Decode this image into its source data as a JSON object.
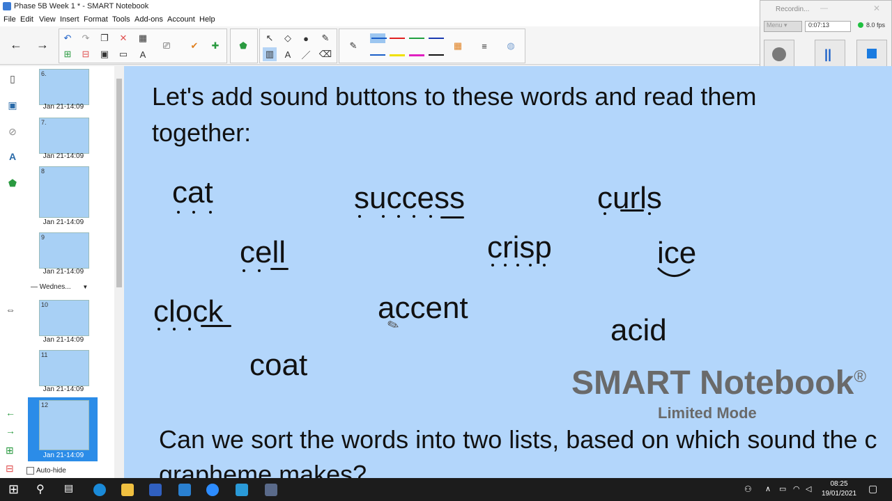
{
  "window": {
    "title": "Phase 5B Week 1 * - SMART Notebook"
  },
  "menu": [
    "File",
    "Edit",
    "View",
    "Insert",
    "Format",
    "Tools",
    "Add-ons",
    "Account",
    "Help"
  ],
  "toolbar": {
    "icons": [
      "back-arrow-icon",
      "forward-arrow-icon",
      "undo-icon",
      "redo-icon",
      "delete-icon",
      "table-icon",
      "screen-shade-icon",
      "shapes-icon",
      "select-icon",
      "pen-icon"
    ],
    "pen_colors": [
      "#1a5fc8",
      "#e02020",
      "#20a040",
      "#1a3ab0",
      "#1a5fc8",
      "#f0e000",
      "#e020c0",
      "#111111"
    ]
  },
  "recorder": {
    "title": "Recordin...",
    "mode": "Menu",
    "elapsed": "0:07:13",
    "fps": "8.0 fps"
  },
  "pages": [
    {
      "num": "6.",
      "date": "Jan 21-14:09"
    },
    {
      "num": "7.",
      "date": "Jan 21-14:09"
    },
    {
      "num": "8",
      "date": "Jan 21-14:09"
    },
    {
      "num": "9",
      "date": "Jan 21-14:09"
    },
    {
      "num": "10",
      "date": "Jan 21-14:09"
    },
    {
      "num": "11",
      "date": "Jan 21-14:09"
    },
    {
      "num": "12",
      "date": "Jan 21-14:09"
    }
  ],
  "section": {
    "label": "Wednes..."
  },
  "autohide": {
    "label": "Auto-hide"
  },
  "canvas": {
    "heading": "Let's add sound buttons to these words and read them together:",
    "words": [
      "cat",
      "success",
      "curls",
      "cell",
      "crisp",
      "ice",
      "clock",
      "accent",
      "acid",
      "coat"
    ],
    "footer": "Can we sort the words into two lists, based on which sound the c grapheme makes?"
  },
  "watermark": {
    "title": "SMART Notebook",
    "reg": "®",
    "subtitle": "Limited Mode"
  },
  "taskbar": {
    "time": "08:25",
    "date": "19/01/2021"
  }
}
